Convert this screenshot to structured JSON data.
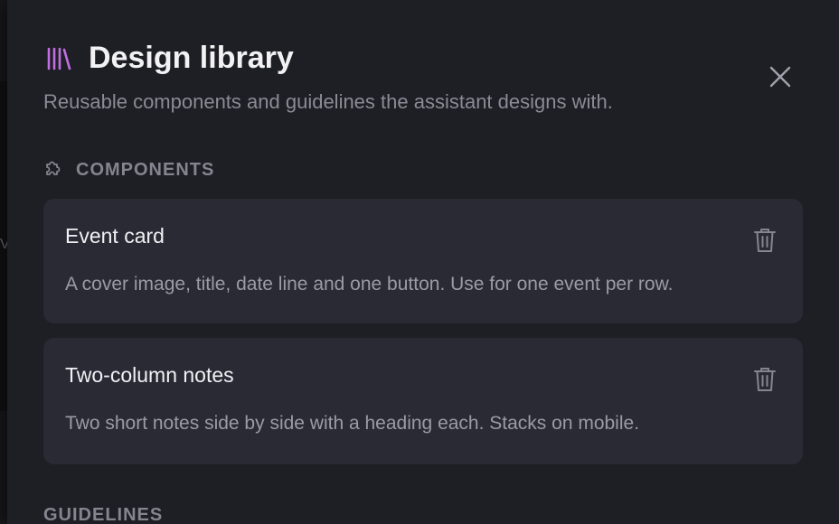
{
  "backdrop": {
    "partial_glyph": "V"
  },
  "panel": {
    "title": "Design library",
    "subtitle": "Reusable components and guidelines the assistant designs with.",
    "header_icon": "library-books-icon",
    "close_icon": "close-icon"
  },
  "sections": {
    "components": {
      "label": "COMPONENTS",
      "icon": "puzzle-icon",
      "items": [
        {
          "title": "Event card",
          "description": "A cover image, title, date line and one button. Use for one event per row.",
          "action_icon": "trash-icon"
        },
        {
          "title": "Two-column notes",
          "description": "Two short notes side by side with a heading each. Stacks on mobile.",
          "action_icon": "trash-icon"
        }
      ]
    },
    "guidelines": {
      "label": "GUIDELINES"
    }
  },
  "colors": {
    "accent": "#c06ee0",
    "panel_bg": "#1e1e25",
    "card_bg": "#2a2a35",
    "muted_text": "#8b8b95"
  }
}
